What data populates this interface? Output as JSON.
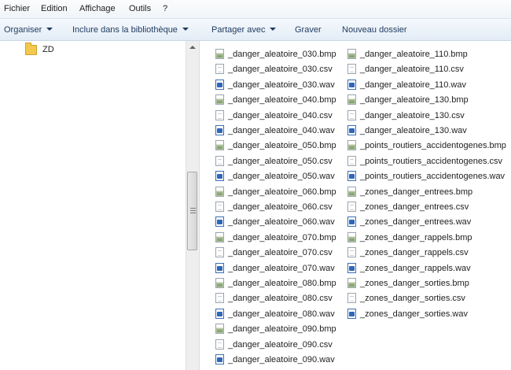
{
  "menu": [
    "Fichier",
    "Edition",
    "Affichage",
    "Outils",
    "?"
  ],
  "toolbar": {
    "organize": "Organiser",
    "include_library": "Inclure dans la bibliothèque",
    "share_with": "Partager avec",
    "burn": "Graver",
    "new_folder": "Nouveau dossier"
  },
  "nav": {
    "folder": "ZD"
  },
  "files_col1": [
    {
      "name": "_danger_aleatoire_030.bmp",
      "type": "bmp"
    },
    {
      "name": "_danger_aleatoire_030.csv",
      "type": "csv"
    },
    {
      "name": "_danger_aleatoire_030.wav",
      "type": "wav"
    },
    {
      "name": "_danger_aleatoire_040.bmp",
      "type": "bmp"
    },
    {
      "name": "_danger_aleatoire_040.csv",
      "type": "csv"
    },
    {
      "name": "_danger_aleatoire_040.wav",
      "type": "wav"
    },
    {
      "name": "_danger_aleatoire_050.bmp",
      "type": "bmp"
    },
    {
      "name": "_danger_aleatoire_050.csv",
      "type": "csv"
    },
    {
      "name": "_danger_aleatoire_050.wav",
      "type": "wav"
    },
    {
      "name": "_danger_aleatoire_060.bmp",
      "type": "bmp"
    },
    {
      "name": "_danger_aleatoire_060.csv",
      "type": "csv"
    },
    {
      "name": "_danger_aleatoire_060.wav",
      "type": "wav"
    },
    {
      "name": "_danger_aleatoire_070.bmp",
      "type": "bmp"
    },
    {
      "name": "_danger_aleatoire_070.csv",
      "type": "csv"
    },
    {
      "name": "_danger_aleatoire_070.wav",
      "type": "wav"
    },
    {
      "name": "_danger_aleatoire_080.bmp",
      "type": "bmp"
    },
    {
      "name": "_danger_aleatoire_080.csv",
      "type": "csv"
    },
    {
      "name": "_danger_aleatoire_080.wav",
      "type": "wav"
    },
    {
      "name": "_danger_aleatoire_090.bmp",
      "type": "bmp"
    },
    {
      "name": "_danger_aleatoire_090.csv",
      "type": "csv"
    },
    {
      "name": "_danger_aleatoire_090.wav",
      "type": "wav"
    }
  ],
  "files_col2": [
    {
      "name": "_danger_aleatoire_110.bmp",
      "type": "bmp"
    },
    {
      "name": "_danger_aleatoire_110.csv",
      "type": "csv"
    },
    {
      "name": "_danger_aleatoire_110.wav",
      "type": "wav"
    },
    {
      "name": "_danger_aleatoire_130.bmp",
      "type": "bmp"
    },
    {
      "name": "_danger_aleatoire_130.csv",
      "type": "csv"
    },
    {
      "name": "_danger_aleatoire_130.wav",
      "type": "wav"
    },
    {
      "name": "_points_routiers_accidentogenes.bmp",
      "type": "bmp"
    },
    {
      "name": "_points_routiers_accidentogenes.csv",
      "type": "csv"
    },
    {
      "name": "_points_routiers_accidentogenes.wav",
      "type": "wav"
    },
    {
      "name": "_zones_danger_entrees.bmp",
      "type": "bmp"
    },
    {
      "name": "_zones_danger_entrees.csv",
      "type": "csv"
    },
    {
      "name": "_zones_danger_entrees.wav",
      "type": "wav"
    },
    {
      "name": "_zones_danger_rappels.bmp",
      "type": "bmp"
    },
    {
      "name": "_zones_danger_rappels.csv",
      "type": "csv"
    },
    {
      "name": "_zones_danger_rappels.wav",
      "type": "wav"
    },
    {
      "name": "_zones_danger_sorties.bmp",
      "type": "bmp"
    },
    {
      "name": "_zones_danger_sorties.csv",
      "type": "csv"
    },
    {
      "name": "_zones_danger_sorties.wav",
      "type": "wav"
    }
  ]
}
